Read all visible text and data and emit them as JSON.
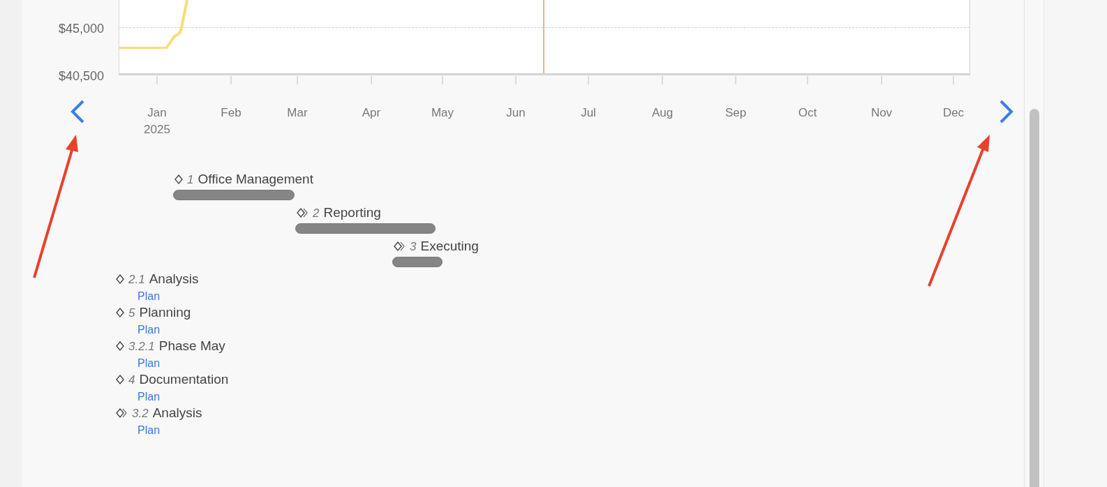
{
  "chart": {
    "y_axis_labels": [
      "$45,000",
      "$40,500"
    ],
    "x_axis_labels": [
      {
        "month": "Jan",
        "year": "2025"
      },
      {
        "month": "Feb"
      },
      {
        "month": "Mar"
      },
      {
        "month": "Apr"
      },
      {
        "month": "May"
      },
      {
        "month": "Jun"
      },
      {
        "month": "Jul"
      },
      {
        "month": "Aug"
      },
      {
        "month": "Sep"
      },
      {
        "month": "Oct"
      },
      {
        "month": "Nov"
      },
      {
        "month": "Dec"
      }
    ]
  },
  "timeline_items": [
    {
      "number": "1",
      "title": "Office Management",
      "kind": "plain"
    },
    {
      "number": "2",
      "title": "Reporting",
      "kind": "nested"
    },
    {
      "number": "3",
      "title": "Executing",
      "kind": "nested"
    }
  ],
  "unscheduled_items": [
    {
      "number": "2.1",
      "title": "Analysis",
      "kind": "plain",
      "link": "Plan"
    },
    {
      "number": "5",
      "title": "Planning",
      "kind": "plain",
      "link": "Plan"
    },
    {
      "number": "3.2.1",
      "title": "Phase May",
      "kind": "plain",
      "link": "Plan"
    },
    {
      "number": "4",
      "title": "Documentation",
      "kind": "plain",
      "link": "Plan"
    },
    {
      "number": "3.2",
      "title": "Analysis",
      "kind": "nested",
      "link": "Plan"
    }
  ]
}
